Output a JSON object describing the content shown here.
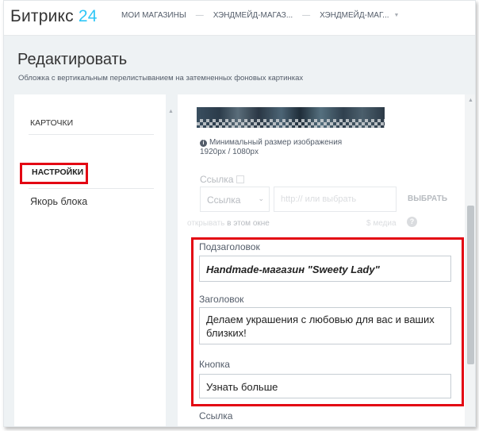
{
  "app": {
    "logo_text": "Битрикс",
    "logo_num": "24"
  },
  "breadcrumbs": [
    "МОИ МАГАЗИНЫ",
    "ХЭНДМЕЙД-МАГАЗ...",
    "ХЭНДМЕЙД-МАГ..."
  ],
  "header": {
    "title": "Редактировать",
    "subtitle": "Обложка с вертикальным перелистыванием на затемненных фоновых картинках"
  },
  "sidebar": {
    "items": [
      {
        "label": "КАРТОЧКИ"
      },
      {
        "label": "НАСТРОЙКИ"
      },
      {
        "label": "Якорь блока"
      }
    ]
  },
  "image_note": {
    "line1": "Минимальный размер изображения",
    "line2": "1920px / 1080px"
  },
  "link": {
    "label": "Ссылка",
    "select_value": "Ссылка",
    "url_placeholder": "http:// или выбрать",
    "choose_label": "ВЫБРАТЬ",
    "open_label": "открывать",
    "open_target": "в этом окне",
    "media_label": "$ медиа"
  },
  "fields": {
    "subheading": {
      "label": "Подзаголовок",
      "value": "Handmade-магазин \"Sweety Lady\""
    },
    "heading": {
      "label": "Заголовок",
      "value": "Делаем украшения с любовью для вас и ваших близких!"
    },
    "button": {
      "label": "Кнопка",
      "value": "Узнать больше"
    },
    "next_label": "Ссылка"
  },
  "colors": {
    "accent": "#2fc6f6",
    "highlight": "#e30613",
    "background": "#eef2f4"
  }
}
